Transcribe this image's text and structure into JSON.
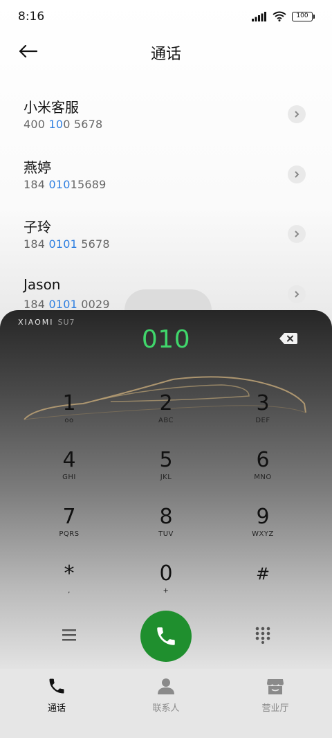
{
  "status_bar": {
    "time": "8:16",
    "battery": "100"
  },
  "header": {
    "title": "通话"
  },
  "calls": [
    {
      "name": "小米客服",
      "number_parts": [
        "400 ",
        "10",
        "0 5678"
      ]
    },
    {
      "name": "燕婷",
      "number_parts": [
        "184 ",
        "010",
        "15689"
      ]
    },
    {
      "name": "子玲",
      "number_parts": [
        "184 ",
        "0101",
        " 5678"
      ]
    },
    {
      "name": "Jason",
      "number_parts": [
        "184 ",
        "0101",
        " 0029"
      ]
    }
  ],
  "dialer": {
    "brand": "XIAOMI",
    "model": "SU7",
    "display": "010",
    "keys": [
      {
        "digit": "1",
        "letters": "ᴏᴏ"
      },
      {
        "digit": "2",
        "letters": "ABC"
      },
      {
        "digit": "3",
        "letters": "DEF"
      },
      {
        "digit": "4",
        "letters": "GHI"
      },
      {
        "digit": "5",
        "letters": "JKL"
      },
      {
        "digit": "6",
        "letters": "MNO"
      },
      {
        "digit": "7",
        "letters": "PQRS"
      },
      {
        "digit": "8",
        "letters": "TUV"
      },
      {
        "digit": "9",
        "letters": "WXYZ"
      },
      {
        "digit": "*",
        "letters": ","
      },
      {
        "digit": "0",
        "letters": "+"
      },
      {
        "digit": "#",
        "letters": ""
      }
    ]
  },
  "bottom_nav": [
    {
      "label": "通话",
      "icon": "phone-icon",
      "active": true
    },
    {
      "label": "联系人",
      "icon": "contact-icon",
      "active": false
    },
    {
      "label": "营业厅",
      "icon": "store-icon",
      "active": false
    }
  ],
  "colors": {
    "accent_blue": "#2f7fe0",
    "dial_green": "#40d66b",
    "call_button": "#1f8f2e"
  }
}
